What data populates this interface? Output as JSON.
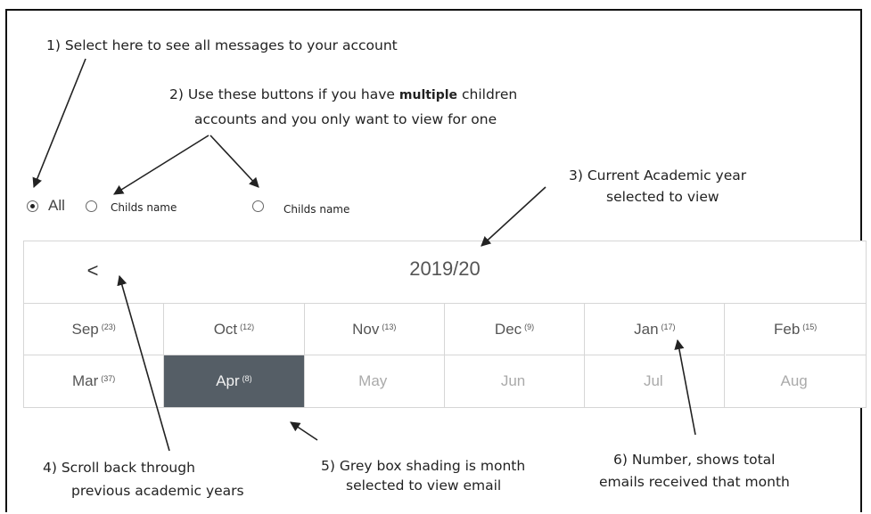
{
  "annotations": {
    "note1": "1)  Select here to see all messages to your account",
    "note2_pre": "2) Use these buttons if you have ",
    "note2_bold": "multiple",
    "note2_post": " children",
    "note2_line2": "accounts and you only want to view for one",
    "note3_line1": "3) Current Academic year",
    "note3_line2": "selected to view",
    "note4_line1": "4) Scroll back through",
    "note4_line2": "previous academic years",
    "note5_line1": "5) Grey box shading is month",
    "note5_line2": "selected to view email",
    "note6_line1": "6) Number, shows total",
    "note6_line2": "emails received that month"
  },
  "filter": {
    "options": [
      {
        "label": "All",
        "checked": true
      },
      {
        "label": "Childs name",
        "checked": false
      },
      {
        "label": "Childs name",
        "checked": false
      }
    ]
  },
  "calendar": {
    "year": "2019/20",
    "prev_label": "<",
    "months": [
      {
        "name": "Sep",
        "count": "(23)",
        "state": "normal"
      },
      {
        "name": "Oct",
        "count": "(12)",
        "state": "normal"
      },
      {
        "name": "Nov",
        "count": "(13)",
        "state": "normal"
      },
      {
        "name": "Dec",
        "count": "(9)",
        "state": "normal"
      },
      {
        "name": "Jan",
        "count": "(17)",
        "state": "normal"
      },
      {
        "name": "Feb",
        "count": "(15)",
        "state": "normal"
      },
      {
        "name": "Mar",
        "count": "(37)",
        "state": "normal"
      },
      {
        "name": "Apr",
        "count": "(8)",
        "state": "selected"
      },
      {
        "name": "May",
        "count": "",
        "state": "disabled"
      },
      {
        "name": "Jun",
        "count": "",
        "state": "disabled"
      },
      {
        "name": "Jul",
        "count": "",
        "state": "disabled"
      },
      {
        "name": "Aug",
        "count": "",
        "state": "disabled"
      }
    ]
  },
  "colors": {
    "selected_bg": "#555e66",
    "border": "#d6d6d6",
    "arrow": "#222222"
  }
}
